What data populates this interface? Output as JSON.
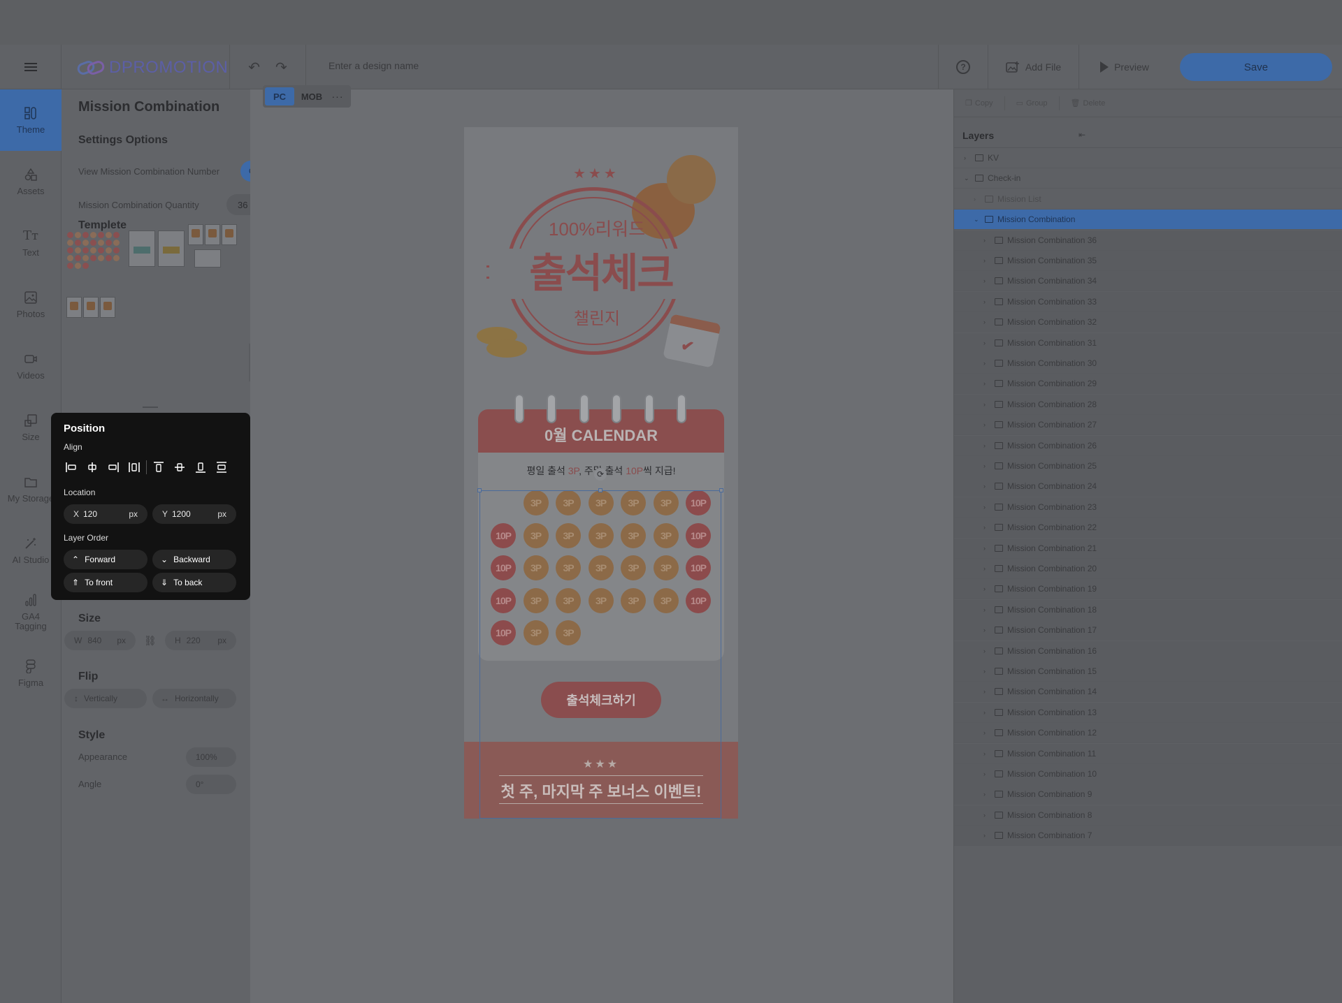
{
  "app": {
    "brand": "DPROMOTION",
    "design_name_placeholder": "Enter a design name",
    "help_label": "?",
    "add_file_label": "Add File",
    "preview_label": "Preview",
    "save_label": "Save",
    "accent_color": "#3d6aa8"
  },
  "rail": [
    {
      "label": "Theme",
      "icon": "theme-icon",
      "active": true
    },
    {
      "label": "Assets",
      "icon": "assets-icon"
    },
    {
      "label": "Text",
      "icon": "text-icon"
    },
    {
      "label": "Photos",
      "icon": "photos-icon"
    },
    {
      "label": "Videos",
      "icon": "videos-icon"
    },
    {
      "label": "Size",
      "icon": "size-icon"
    },
    {
      "label": "My Storage",
      "icon": "folder-icon"
    },
    {
      "label": "AI Studio",
      "icon": "magic-wand-icon"
    },
    {
      "label": "GA4 Tagging",
      "icon": "bar-chart-icon"
    },
    {
      "label": "Figma",
      "icon": "figma-icon"
    }
  ],
  "panel": {
    "title": "Mission Combination",
    "settings_title": "Settings Options",
    "view_number_label": "View Mission Combination Number",
    "view_number_toggle": "ON",
    "quantity_label": "Mission Combination Quantity",
    "quantity_value": "36",
    "template_title": "Templete"
  },
  "position": {
    "title": "Position",
    "align_label": "Align",
    "location_label": "Location",
    "x_key": "X",
    "x_value": "120",
    "x_unit": "px",
    "y_key": "Y",
    "y_value": "1200",
    "y_unit": "px",
    "layer_order_label": "Layer Order",
    "forward": "Forward",
    "backward": "Backward",
    "to_front": "To front",
    "to_back": "To back"
  },
  "size": {
    "title": "Size",
    "w_key": "W",
    "w_value": "840",
    "w_unit": "px",
    "h_key": "H",
    "h_value": "220",
    "h_unit": "px"
  },
  "flip": {
    "title": "Flip",
    "vertically": "Vertically",
    "horizontally": "Horizontally"
  },
  "style": {
    "title": "Style",
    "appearance_label": "Appearance",
    "appearance_value": "100%",
    "angle_label": "Angle",
    "angle_value": "0°"
  },
  "device_tabs": {
    "pc": "PC",
    "mob": "MOB",
    "more": "···"
  },
  "artboard": {
    "stars": "★★★",
    "reward": "100%리워드",
    "banner": "출석체크",
    "challenge": "챌린지",
    "calendar_title": "0월 CALENDAR",
    "sub_a": "평일 출석 ",
    "sub_b": "3P",
    "sub_c": ", 주말 출석 ",
    "sub_d": "10P",
    "sub_e": "씩 지급!",
    "cells": [
      "3P",
      "3P",
      "3P",
      "3P",
      "3P",
      "10P",
      "10P",
      "3P",
      "3P",
      "3P",
      "3P",
      "3P",
      "10P",
      "10P",
      "3P",
      "3P",
      "3P",
      "3P",
      "3P",
      "10P",
      "10P",
      "3P",
      "3P",
      "3P",
      "3P",
      "3P",
      "10P",
      "10P",
      "3P",
      "3P"
    ],
    "check_button": "출석체크하기",
    "bonus_stars": "★★★",
    "bonus_text": "첫 주, 마지막 주 보너스 이벤트!"
  },
  "right": {
    "copy": "Copy",
    "group": "Group",
    "delete": "Delete",
    "layers_title": "Layers",
    "tree": [
      {
        "label": "KV",
        "level": 0,
        "kind": "folder"
      },
      {
        "label": "Check-in",
        "level": 0,
        "kind": "stamp",
        "open": true
      },
      {
        "label": "Mission List",
        "level": 1,
        "kind": "list",
        "dim": true
      },
      {
        "label": "Mission Combination",
        "level": 1,
        "kind": "list",
        "open": true,
        "selected": true
      },
      {
        "label": "Mission Combination 36",
        "level": 2
      },
      {
        "label": "Mission Combination 35",
        "level": 2
      },
      {
        "label": "Mission Combination 34",
        "level": 2
      },
      {
        "label": "Mission Combination 33",
        "level": 2
      },
      {
        "label": "Mission Combination 32",
        "level": 2
      },
      {
        "label": "Mission Combination 31",
        "level": 2
      },
      {
        "label": "Mission Combination 30",
        "level": 2
      },
      {
        "label": "Mission Combination 29",
        "level": 2
      },
      {
        "label": "Mission Combination 28",
        "level": 2
      },
      {
        "label": "Mission Combination 27",
        "level": 2
      },
      {
        "label": "Mission Combination 26",
        "level": 2
      },
      {
        "label": "Mission Combination 25",
        "level": 2
      },
      {
        "label": "Mission Combination 24",
        "level": 2
      },
      {
        "label": "Mission Combination 23",
        "level": 2
      },
      {
        "label": "Mission Combination 22",
        "level": 2
      },
      {
        "label": "Mission Combination 21",
        "level": 2
      },
      {
        "label": "Mission Combination 20",
        "level": 2
      },
      {
        "label": "Mission Combination 19",
        "level": 2
      },
      {
        "label": "Mission Combination 18",
        "level": 2
      },
      {
        "label": "Mission Combination 17",
        "level": 2
      },
      {
        "label": "Mission Combination 16",
        "level": 2
      },
      {
        "label": "Mission Combination 15",
        "level": 2
      },
      {
        "label": "Mission Combination 14",
        "level": 2
      },
      {
        "label": "Mission Combination 13",
        "level": 2
      },
      {
        "label": "Mission Combination 12",
        "level": 2
      },
      {
        "label": "Mission Combination 11",
        "level": 2
      },
      {
        "label": "Mission Combination 10",
        "level": 2
      },
      {
        "label": "Mission Combination 9",
        "level": 2
      },
      {
        "label": "Mission Combination 8",
        "level": 2
      },
      {
        "label": "Mission Combination 7",
        "level": 2
      }
    ]
  }
}
